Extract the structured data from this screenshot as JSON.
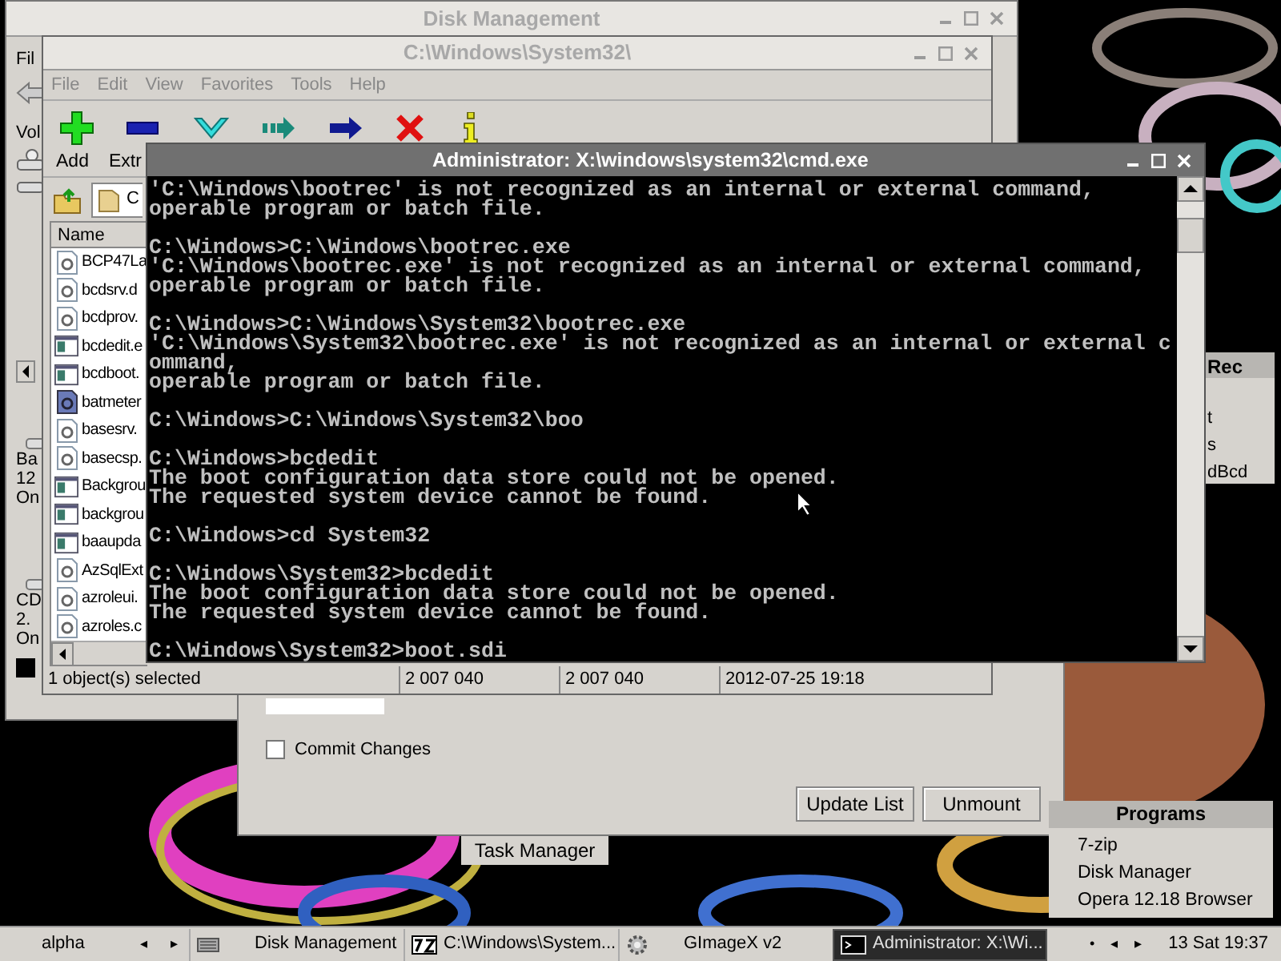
{
  "disk_management": {
    "title": "Disk Management",
    "menu": "Fil",
    "column": "Vol",
    "volumes": [
      [
        "Ba",
        "12",
        "On"
      ],
      [
        "CD",
        "2.",
        "On"
      ]
    ]
  },
  "explorer": {
    "title": "C:\\Windows\\System32\\",
    "menu": [
      "File",
      "Edit",
      "View",
      "Favorites",
      "Tools",
      "Help"
    ],
    "toolbar": [
      {
        "kind": "add",
        "label": "Add"
      },
      {
        "kind": "extract",
        "label": "Extr"
      },
      {
        "kind": "test"
      },
      {
        "kind": "copy"
      },
      {
        "kind": "move"
      },
      {
        "kind": "delete"
      },
      {
        "kind": "info"
      }
    ],
    "path": "C",
    "column": "Name",
    "files": [
      {
        "name": "BCP47La",
        "kind": "dll"
      },
      {
        "name": "bcdsrv.d",
        "kind": "dll"
      },
      {
        "name": "bcdprov.",
        "kind": "dll"
      },
      {
        "name": "bcdedit.e",
        "kind": "exe"
      },
      {
        "name": "bcdboot.",
        "kind": "exe"
      },
      {
        "name": "batmeter",
        "kind": "cpl"
      },
      {
        "name": "basesrv.",
        "kind": "dll"
      },
      {
        "name": "basecsp.",
        "kind": "dll"
      },
      {
        "name": "Backgrou",
        "kind": "exe"
      },
      {
        "name": "backgrou",
        "kind": "exe"
      },
      {
        "name": "baaupda",
        "kind": "exe"
      },
      {
        "name": "AzSqlExt",
        "kind": "dll"
      },
      {
        "name": "azroleui.",
        "kind": "dll"
      },
      {
        "name": "azroles.c",
        "kind": "dll"
      }
    ],
    "status": [
      "1 object(s) selected",
      "2 007 040",
      "2 007 040",
      "2012-07-25 19:18"
    ]
  },
  "gimagex": {
    "commit": {
      "label": "Commit Changes",
      "checked": false
    },
    "buttons": [
      "Update List",
      "Unmount"
    ],
    "tab": "Task Manager"
  },
  "cmd": {
    "title": "Administrator: X:\\windows\\system32\\cmd.exe",
    "blocks": [
      [
        "'C:\\Windows\\bootrec' is not recognized as an internal or external command,",
        "operable program or batch file."
      ],
      [
        "C:\\Windows>C:\\Windows\\bootrec.exe",
        "'C:\\Windows\\bootrec.exe' is not recognized as an internal or external command,",
        "operable program or batch file."
      ],
      [
        "C:\\Windows>C:\\Windows\\System32\\bootrec.exe",
        "'C:\\Windows\\System32\\bootrec.exe' is not recognized as an internal or external c",
        "ommand,",
        "operable program or batch file."
      ],
      [
        "C:\\Windows>C:\\Windows\\System32\\boo"
      ],
      [
        "C:\\Windows>bcdedit",
        "The boot configuration data store could not be opened.",
        "The requested system device cannot be found."
      ],
      [
        "C:\\Windows>cd System32"
      ],
      [
        "C:\\Windows\\System32>bcdedit",
        "The boot configuration data store could not be opened.",
        "The requested system device cannot be found."
      ],
      [
        "C:\\Windows\\System32>boot.sdi"
      ]
    ]
  },
  "side_menu": {
    "title": "Rec",
    "items": [
      "t",
      "s",
      "dBcd"
    ]
  },
  "programs_menu": {
    "title": "Programs",
    "items": [
      "7-zip",
      "Disk Manager",
      "Opera 12.18 Browser"
    ]
  },
  "taskbar": {
    "workspace": "alpha",
    "prev": "◂",
    "next": "▸",
    "tasks": [
      {
        "kind": "disk",
        "label": "Disk Management",
        "selected": false
      },
      {
        "kind": "zip",
        "label": "C:\\Windows\\System...",
        "selected": false
      },
      {
        "kind": "gear",
        "label": "GImageX v2",
        "selected": false
      },
      {
        "kind": "console",
        "label": "Administrator: X:\\Wi...",
        "selected": true
      }
    ],
    "tray": [
      "•",
      "◂",
      "▸"
    ],
    "clock": "13 Sat 19:37"
  }
}
